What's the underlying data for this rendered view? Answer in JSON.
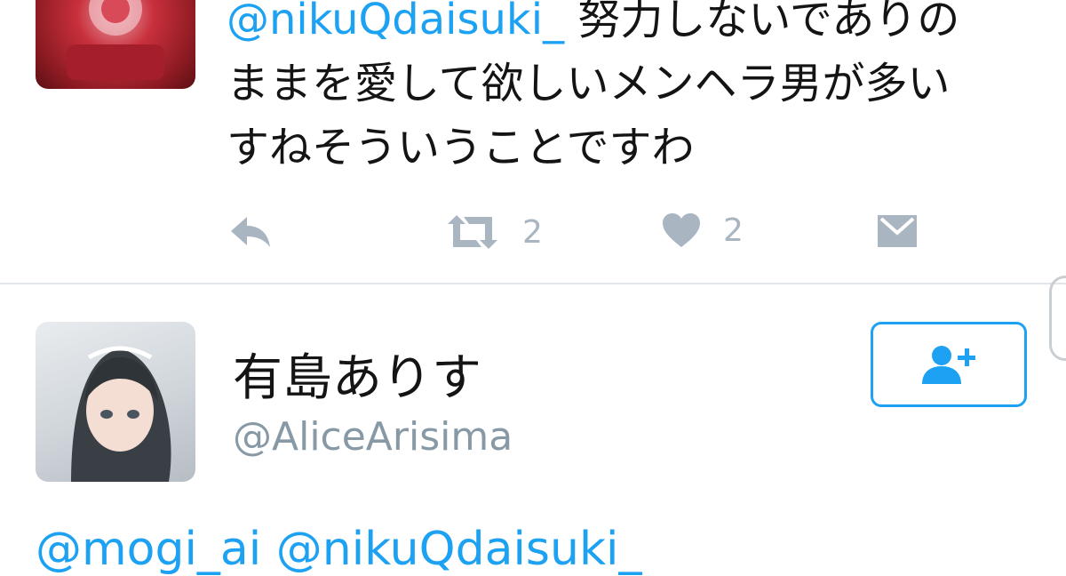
{
  "tweet": {
    "mention": "@nikuQdaisuki_",
    "text_line1": " 努力しないでありの",
    "text_line2": "ままを愛して欲しいメンヘラ男が多い",
    "text_line3": "すねそういうことですわ",
    "retweet_count": "2",
    "like_count": "2"
  },
  "profile": {
    "display_name": "有島ありす",
    "handle": "@AliceArisima"
  },
  "reply": {
    "mentions": "@mogi_ai @nikuQdaisuki_"
  },
  "icons": {
    "reply": "reply-icon",
    "retweet": "retweet-icon",
    "like": "heart-icon",
    "dm": "envelope-icon",
    "follow": "add-user-icon"
  },
  "colors": {
    "accent": "#1da1f2",
    "action_gray": "#a9b5c0",
    "handle_gray": "#8899a6"
  }
}
